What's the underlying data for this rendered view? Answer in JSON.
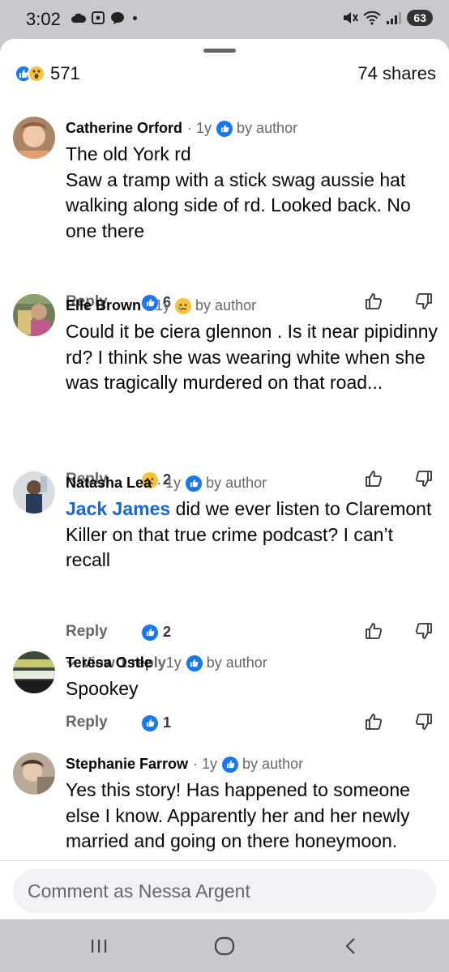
{
  "status": {
    "time": "3:02",
    "battery": "63"
  },
  "post": {
    "reaction_count": "571",
    "shares": "74 shares"
  },
  "comments": [
    {
      "name": "Catherine Orford",
      "age": "1y",
      "author_reaction": "like",
      "by_author": "by author",
      "text": "The old York rd\nSaw a tramp with a stick swag aussie hat walking along side of rd. Looked back. No one there",
      "reply_label": "Reply",
      "reaction_type": "like",
      "reaction_count": "6"
    },
    {
      "name": "Elle Brown",
      "age": "1y",
      "author_reaction": "sad",
      "by_author": "by author",
      "text": "Could it be ciera glennon . Is it near pipidinny rd? I think she was wearing white when she was tragically murdered on that road...",
      "reply_label": "Reply",
      "reaction_type": "sad",
      "reaction_count": "2"
    },
    {
      "name": "Natasha Lea",
      "age": "1y",
      "author_reaction": "like",
      "by_author": "by author",
      "mention": "Jack James",
      "text": " did we ever listen to Claremont Killer on that true crime podcast? I can’t recall",
      "reply_label": "Reply",
      "reaction_type": "like",
      "reaction_count": "2",
      "view_replies": "View 1 reply"
    },
    {
      "name": "Teresa Ostle",
      "age": "1y",
      "author_reaction": "like",
      "by_author": "by author",
      "text": "Spookey",
      "reply_label": "Reply",
      "reaction_type": "like",
      "reaction_count": "1"
    },
    {
      "name": "Stephanie Farrow",
      "age": "1y",
      "author_reaction": "like",
      "by_author": "by author",
      "text": "Yes this story! Has happened to someone else I know. Apparently her and her newly married and going on there honeymoon."
    }
  ],
  "composer": {
    "placeholder": "Comment as Nessa Argent"
  },
  "nav": {
    "recents_icon": "recents-icon",
    "home_icon": "home-icon",
    "back_icon": "back-icon"
  },
  "colors": {
    "accent": "#1877f2",
    "mention": "#1a66d8",
    "muted": "#65676b"
  }
}
